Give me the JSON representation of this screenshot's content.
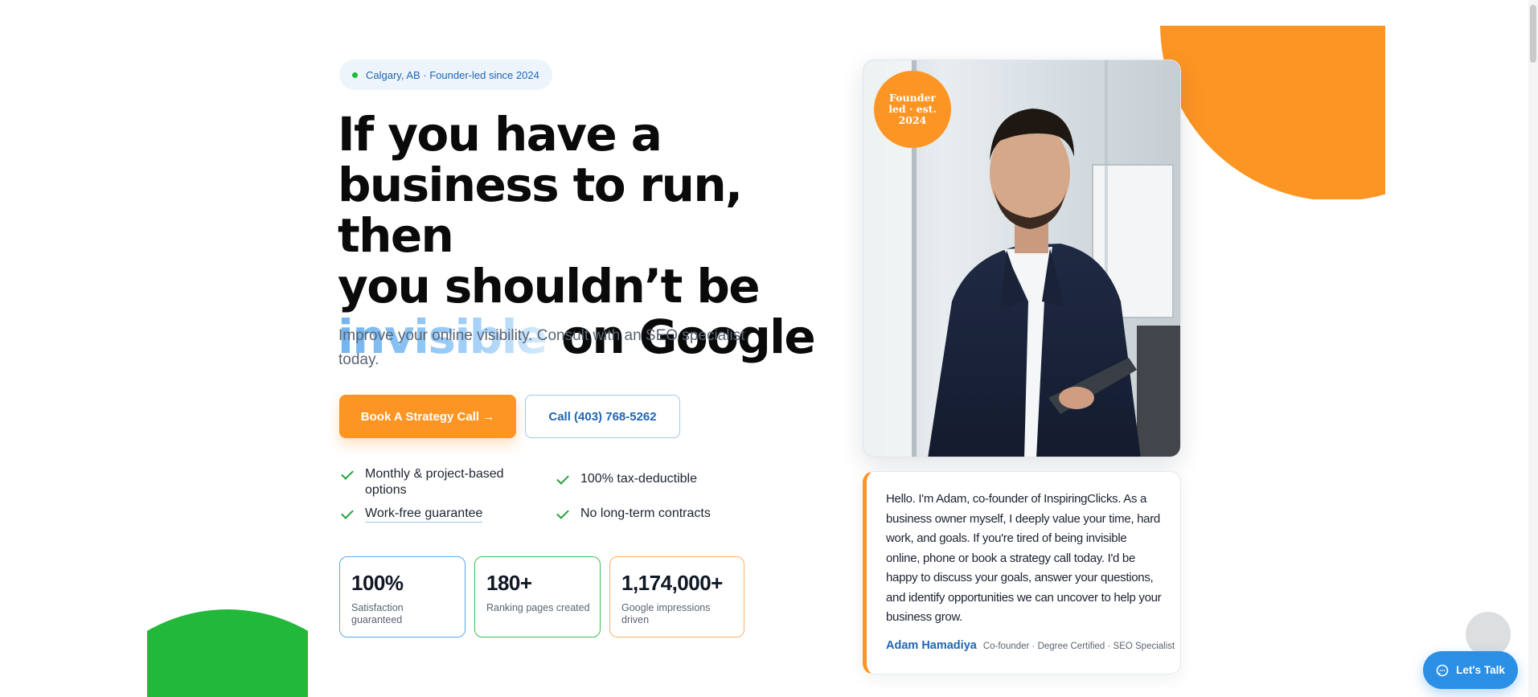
{
  "hero": {
    "badge": "Calgary, AB · Founder-led since 2024",
    "headline_1": "If you have a",
    "headline_2": "business to run, then",
    "headline_3": "you shouldn’t be",
    "headline_highlight": "invisible",
    "headline_4": " on Google",
    "subtitle": "Improve your online visibility. Consult with an SEO specialist today.",
    "cta_primary": "Book A Strategy Call →",
    "cta_secondary": "Call (403) 768-5262"
  },
  "features": [
    {
      "label": "Monthly & project-based options"
    },
    {
      "label": "100% tax-deductible"
    },
    {
      "label": "Work-free guarantee"
    },
    {
      "label": "No long-term contracts"
    }
  ],
  "stats": [
    {
      "value": "100%",
      "label": "Satisfaction guaranteed",
      "color": "#5aa8ec"
    },
    {
      "value": "180+",
      "label": "Ranking pages created",
      "color": "#3bbf4e"
    },
    {
      "value": "1,174,000+",
      "label": "Google impressions driven",
      "color": "#fdb064"
    }
  ],
  "founder_badge": "Founder led · est. 2024",
  "quote": {
    "text": "Hello. I'm Adam, co-founder of InspiringClicks. As a business owner myself, I deeply value your time, hard work, and goals. If you're tired of being invisible online, phone or book a strategy call today. I'd be happy to discuss your goals, answer your questions, and identify opportunities we can uncover to help your business grow.",
    "name": "Adam Hamadiya",
    "role": "Co-founder · Degree Certified · SEO Specialist"
  },
  "chat": {
    "label": "Let's Talk",
    "icon": "chat-bubble-icon"
  },
  "colors": {
    "accent": "#fd9524",
    "brand_blue": "#1f66b3",
    "green": "#22b83a"
  }
}
